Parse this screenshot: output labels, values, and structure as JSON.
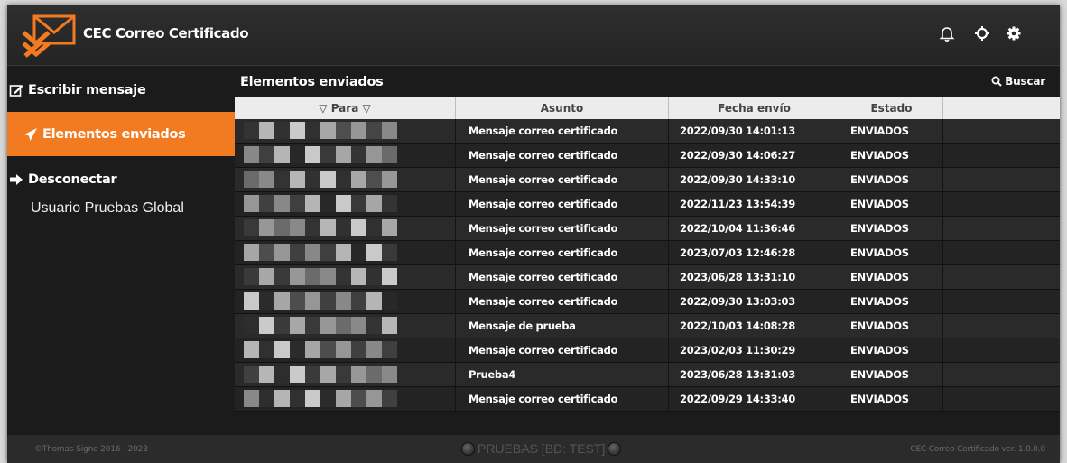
{
  "app": {
    "title": "CEC Correo Certificado"
  },
  "sidebar": {
    "items": [
      {
        "label": "Escribir mensaje",
        "icon": "edit-icon"
      },
      {
        "label": "Elementos enviados",
        "icon": "send-icon"
      },
      {
        "label": "Desconectar",
        "icon": "sign-out-icon"
      }
    ],
    "user": "Usuario Pruebas Global"
  },
  "main": {
    "title": "Elementos enviados",
    "search_label": "Buscar",
    "columns": [
      "▽ Para ▽",
      "Asunto",
      "Fecha envío",
      "Estado",
      ""
    ],
    "rows": [
      {
        "subject": "Mensaje correo certificado",
        "date": "2022/09/30 14:01:13",
        "status": "ENVIADOS"
      },
      {
        "subject": "Mensaje correo certificado",
        "date": "2022/09/30 14:06:27",
        "status": "ENVIADOS"
      },
      {
        "subject": "Mensaje correo certificado",
        "date": "2022/09/30 14:33:10",
        "status": "ENVIADOS"
      },
      {
        "subject": "Mensaje correo certificado",
        "date": "2022/11/23 13:54:39",
        "status": "ENVIADOS"
      },
      {
        "subject": "Mensaje correo certificado",
        "date": "2022/10/04 11:36:46",
        "status": "ENVIADOS"
      },
      {
        "subject": "Mensaje correo certificado",
        "date": "2023/07/03 12:46:28",
        "status": "ENVIADOS"
      },
      {
        "subject": "Mensaje correo certificado",
        "date": "2023/06/28 13:31:10",
        "status": "ENVIADOS"
      },
      {
        "subject": "Mensaje correo certificado",
        "date": "2022/09/30 13:03:03",
        "status": "ENVIADOS"
      },
      {
        "subject": "Mensaje de prueba",
        "date": "2022/10/03 14:08:28",
        "status": "ENVIADOS"
      },
      {
        "subject": "Mensaje correo certificado",
        "date": "2023/02/03 11:30:29",
        "status": "ENVIADOS"
      },
      {
        "subject": "Prueba4",
        "date": "2023/06/28 13:31:03",
        "status": "ENVIADOS"
      },
      {
        "subject": "Mensaje correo certificado",
        "date": "2022/09/29 14:33:40",
        "status": "ENVIADOS"
      }
    ]
  },
  "footer": {
    "copyright": "©Thomas-Signe 2016 - 2023",
    "environment": "PRUEBAS [BD: TEST]",
    "version": "CEC Correo Certificado ver. 1.0.0.0"
  },
  "colors": {
    "accent": "#f27b22",
    "background": "#1b1b1b",
    "header": "#2b2b2b"
  },
  "icons": [
    "bell-icon",
    "brightness-icon",
    "gear-icon",
    "search-icon"
  ]
}
